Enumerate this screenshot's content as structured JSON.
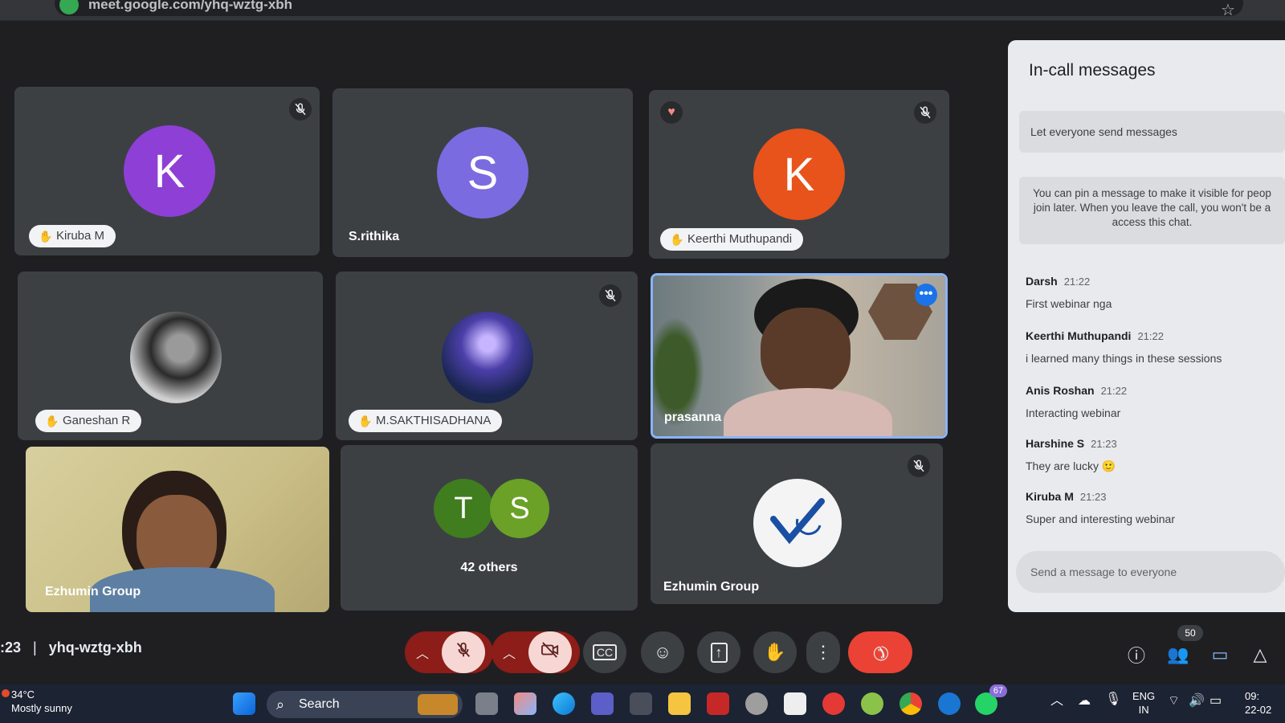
{
  "browser": {
    "url": "meet.google.com/yhq-wztg-xbh"
  },
  "tiles": [
    {
      "name": "Kiruba M",
      "initial": "K",
      "color": "#8e3fd6",
      "hand": true,
      "muted": true
    },
    {
      "name": "S.rithika",
      "initial": "S",
      "color": "#7a6be0",
      "hand": false,
      "muted": false
    },
    {
      "name": "Keerthi Muthupandi",
      "initial": "K",
      "color": "#e8521b",
      "hand": true,
      "muted": true,
      "reaction": "heart"
    },
    {
      "name": "Ganeshan R",
      "hand": true,
      "muted": false
    },
    {
      "name": "M.SAKTHISADHANA",
      "hand": true,
      "muted": true
    },
    {
      "name": "prasanna",
      "speaking": true,
      "more_icon": "more-horizontal-icon"
    },
    {
      "name": "Ezhumin Group",
      "camera": true
    },
    {
      "name": "42 others",
      "initials": [
        "T",
        "S"
      ],
      "colors": [
        "#3f7d1e",
        "#6aa126"
      ]
    },
    {
      "name": "Ezhumin Group",
      "muted": true,
      "logo": true
    }
  ],
  "chat": {
    "title": "In-call messages",
    "toggle_label": "Let everyone send messages",
    "info": "You can pin a message to make it visible for peop join later. When you leave the call, you won't be a access this chat.",
    "messages": [
      {
        "sender": "Darsh",
        "time": "21:22",
        "text": "First webinar nga"
      },
      {
        "sender": "Keerthi Muthupandi",
        "time": "21:22",
        "text": "i learned many things in these sessions"
      },
      {
        "sender": "Anis Roshan",
        "time": "21:22",
        "text": "Interacting webinar"
      },
      {
        "sender": "Harshine S",
        "time": "21:23",
        "text": "They are lucky 🙂"
      },
      {
        "sender": "Kiruba M",
        "time": "21:23",
        "text": "Super and interesting webinar"
      }
    ],
    "input_placeholder": "Send a message to everyone"
  },
  "bottom": {
    "time": ":23",
    "separator": "|",
    "meeting_code": "yhq-wztg-xbh",
    "people_count": "50"
  },
  "taskbar": {
    "temperature": "34°C",
    "weather": "Mostly sunny",
    "search_label": "Search",
    "lang_top": "ENG",
    "lang_bottom": "IN",
    "clock_top": "09:",
    "clock_bottom": "22-02",
    "whatsapp_badge": "67",
    "weather_badge": "4"
  },
  "colors": {
    "end_call": "#ea4335",
    "speaking_border": "#8ab4f8",
    "panel_bg": "#e8eaed"
  }
}
